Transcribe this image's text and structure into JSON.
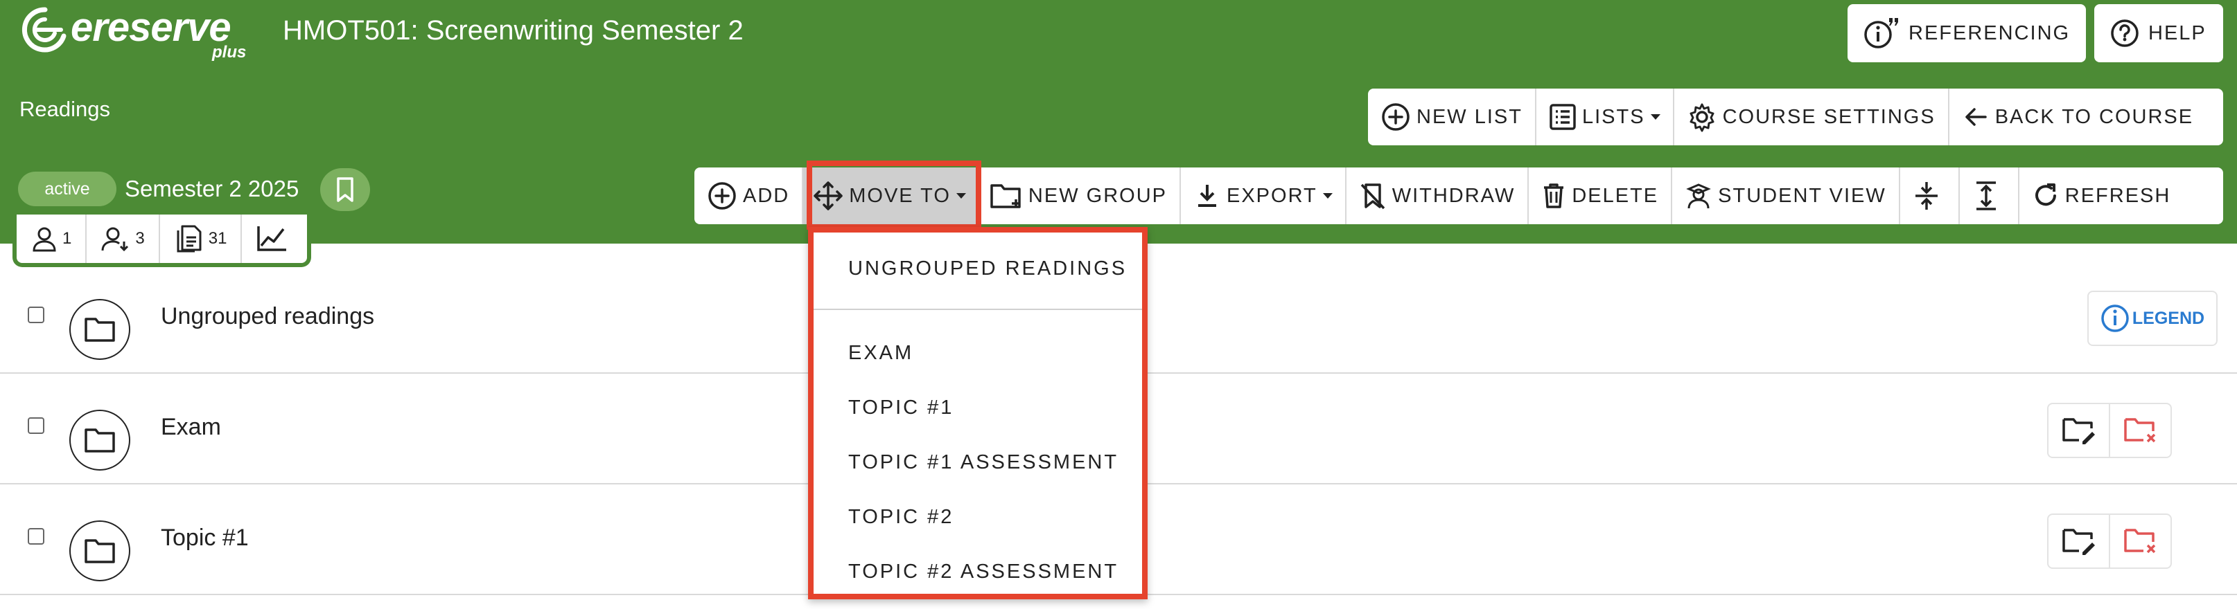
{
  "header": {
    "logo_text": "ereserve",
    "logo_sub": "plus",
    "course_title": "HMOT501: Screenwriting Semester 2",
    "section_label": "Readings",
    "referencing_label": "Referencing",
    "help_label": "Help",
    "status": "active",
    "semester": "Semester 2 2025"
  },
  "top_actions": {
    "new_list": "New List",
    "lists": "Lists",
    "course_settings": "Course Settings",
    "back_to_course": "Back to Course"
  },
  "toolbar": {
    "add": "Add",
    "move_to": "Move To",
    "new_group": "New Group",
    "export": "Export",
    "withdraw": "Withdraw",
    "delete": "Delete",
    "student_view": "Student View",
    "refresh": "Refresh"
  },
  "stats": {
    "users": "1",
    "pending_users": "3",
    "documents": "31"
  },
  "groups": [
    {
      "label": "Ungrouped readings"
    },
    {
      "label": "Exam"
    },
    {
      "label": "Topic #1"
    }
  ],
  "legend_label": "Legend",
  "move_to_menu": {
    "items": [
      "Ungrouped Readings",
      "Exam",
      "Topic #1",
      "Topic #1 Assessment",
      "Topic #2",
      "Topic #2 Assessment"
    ]
  },
  "colors": {
    "header_green": "#4c8b35",
    "pill_green": "#7cb05f",
    "highlight_red": "#e5432d",
    "legend_blue": "#2a7bd0",
    "delete_red": "#e05555"
  }
}
